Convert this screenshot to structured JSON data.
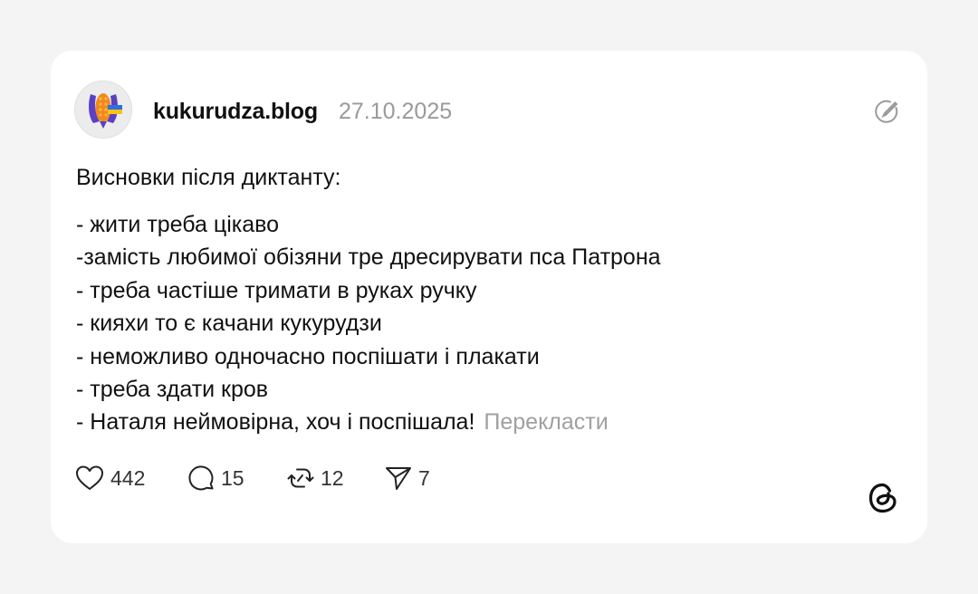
{
  "post": {
    "username": "kukurudza.blog",
    "date": "27.10.2025",
    "intro": "Висновки після диктанту:",
    "lines": [
      "- жити треба цікаво",
      "-замість любимої обізяни тре дресирувати пса Патрона",
      "- треба частіше тримати в руках ручку",
      "- кияхи то є качани кукурудзи",
      "- неможливо одночасно поспішати і плакати",
      "- треба здати кров",
      "- Наталя неймовірна, хоч і поспішала!"
    ],
    "translate_label": "Перекласти"
  },
  "actions": {
    "likes": "442",
    "comments": "15",
    "reposts": "12",
    "shares": "7"
  },
  "icons": {
    "avatar": "corn-avatar-icon",
    "edit": "edit-circle-icon",
    "like": "heart-icon",
    "comment": "comment-bubble-icon",
    "repost": "repost-icon",
    "share": "send-icon",
    "brand": "threads-logo-icon"
  },
  "colors": {
    "background": "#f4f4f5",
    "card": "#ffffff",
    "text": "#111111",
    "muted": "#9a9a9a",
    "avatar_purple": "#5b3fc4",
    "avatar_orange": "#f08a1c",
    "avatar_yellow": "#f5c518",
    "avatar_blue": "#2f6fe0"
  }
}
